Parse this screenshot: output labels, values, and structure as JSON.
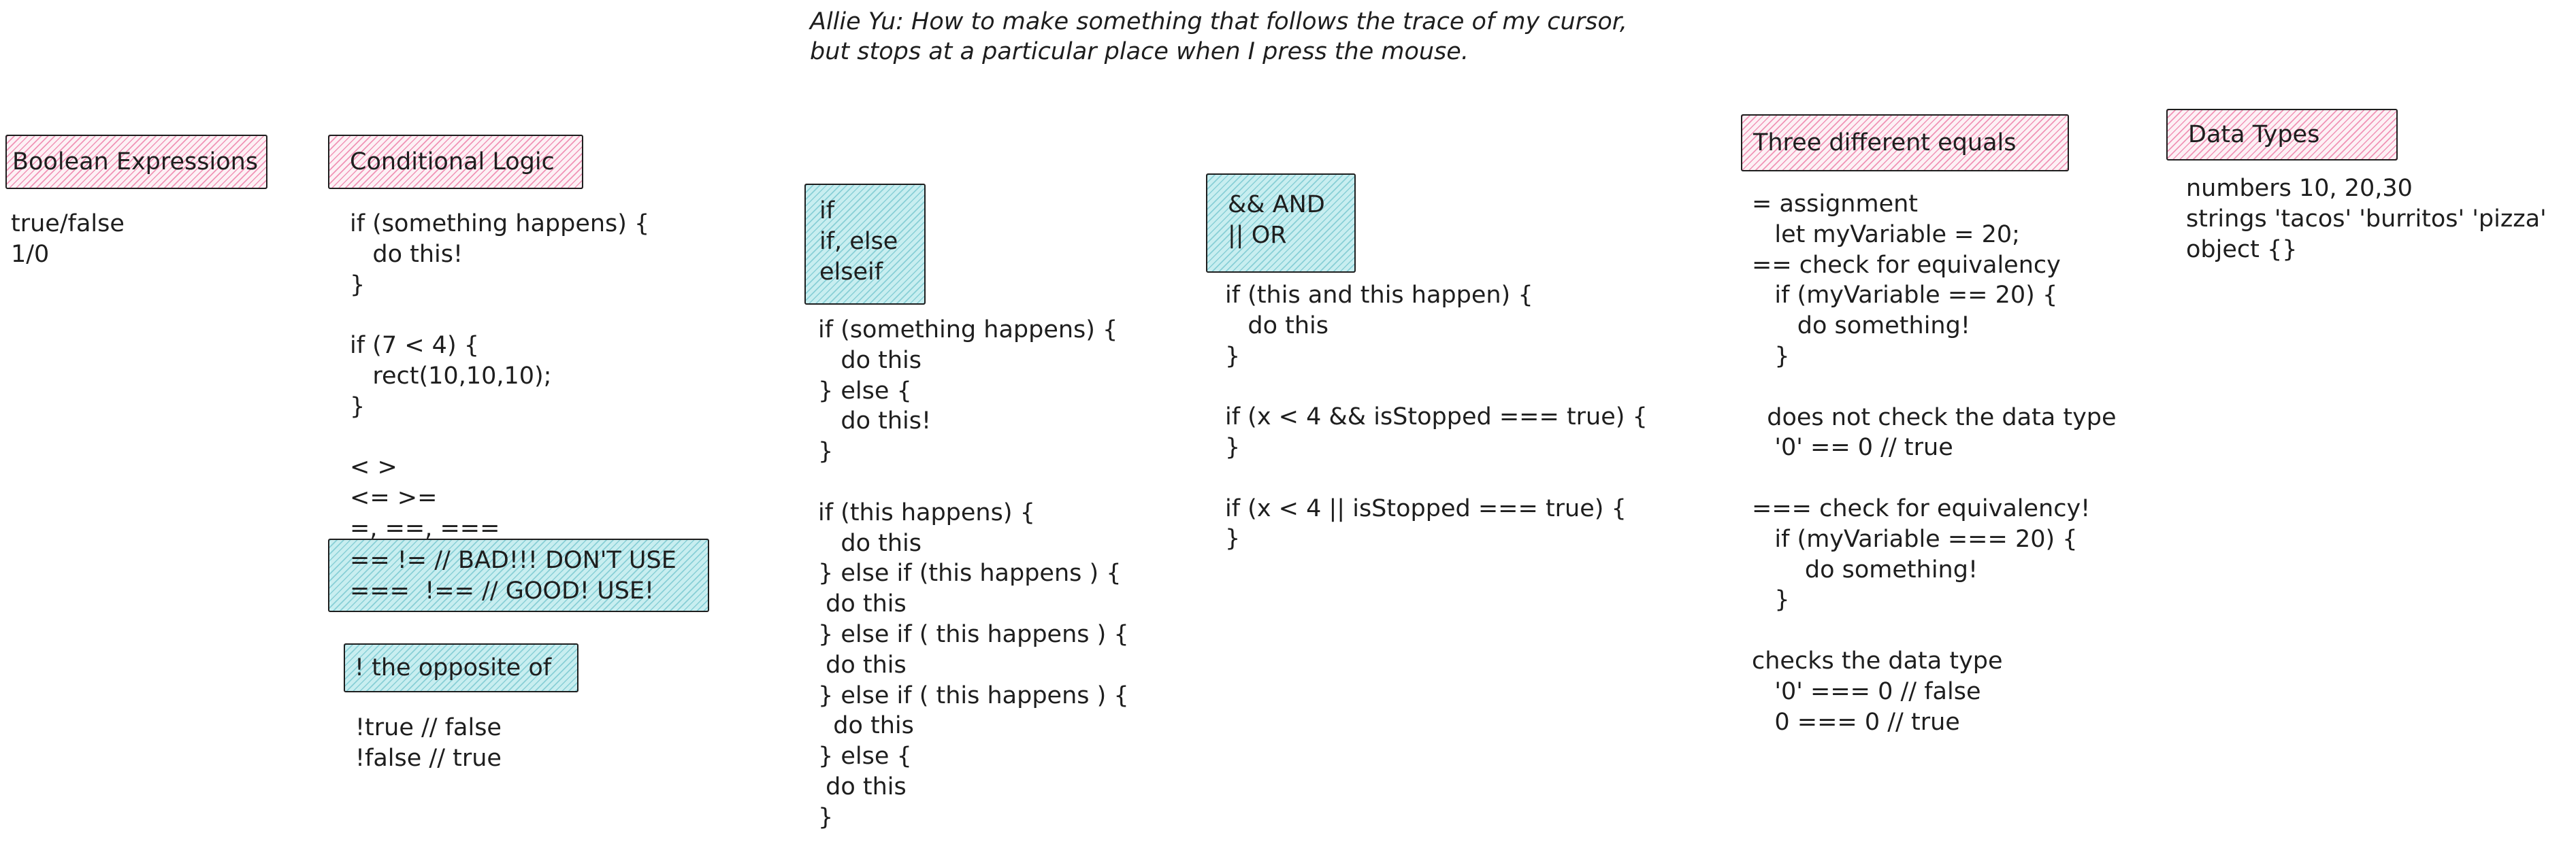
{
  "header": {
    "question_line1": "Allie Yu: How to make something that follows the trace of my cursor,",
    "question_line2": "but stops at a particular place when I press the mouse."
  },
  "boolean_expressions": {
    "title": "Boolean Expressions",
    "body": "true/false\n1/0"
  },
  "conditional_logic": {
    "title": "Conditional Logic",
    "body": "if (something happens) {\n   do this!\n}\n\nif (7 < 4) {\n   rect(10,10,10);\n}\n\n< >\n<= >=\n=, ==, ===",
    "bad_good_note": "== != // BAD!!! DON'T USE\n===  !== // GOOD! USE!",
    "not_title": "! the opposite of",
    "not_body": "!true // false\n!false // true"
  },
  "if_else": {
    "title": "if\nif, else\nelseif",
    "body": "if (something happens) {\n   do this\n} else {\n   do this!\n}\n\nif (this happens) {\n   do this\n} else if (this happens ) {\n do this\n} else if ( this happens ) {\n do this\n} else if ( this happens ) {\n  do this\n} else {\n do this\n}"
  },
  "and_or": {
    "title": "&& AND\n|| OR",
    "body": "if (this and this happen) {\n   do this\n}\n\nif (x < 4 && isStopped === true) {\n}\n\nif (x < 4 || isStopped === true) {\n}"
  },
  "three_equals": {
    "title": "Three different equals",
    "body": "= assignment\n   let myVariable = 20;\n== check for equivalency\n   if (myVariable == 20) {\n      do something!\n   }\n\n  does not check the data type\n   '0' == 0 // true\n\n=== check for equivalency!\n   if (myVariable === 20) {\n       do something!\n   }\n\nchecks the data type\n   '0' === 0 // false\n   0 === 0 // true"
  },
  "data_types": {
    "title": "Data Types",
    "body": "numbers 10, 20,30\nstrings 'tacos' 'burritos' 'pizza'\nobject {}"
  }
}
